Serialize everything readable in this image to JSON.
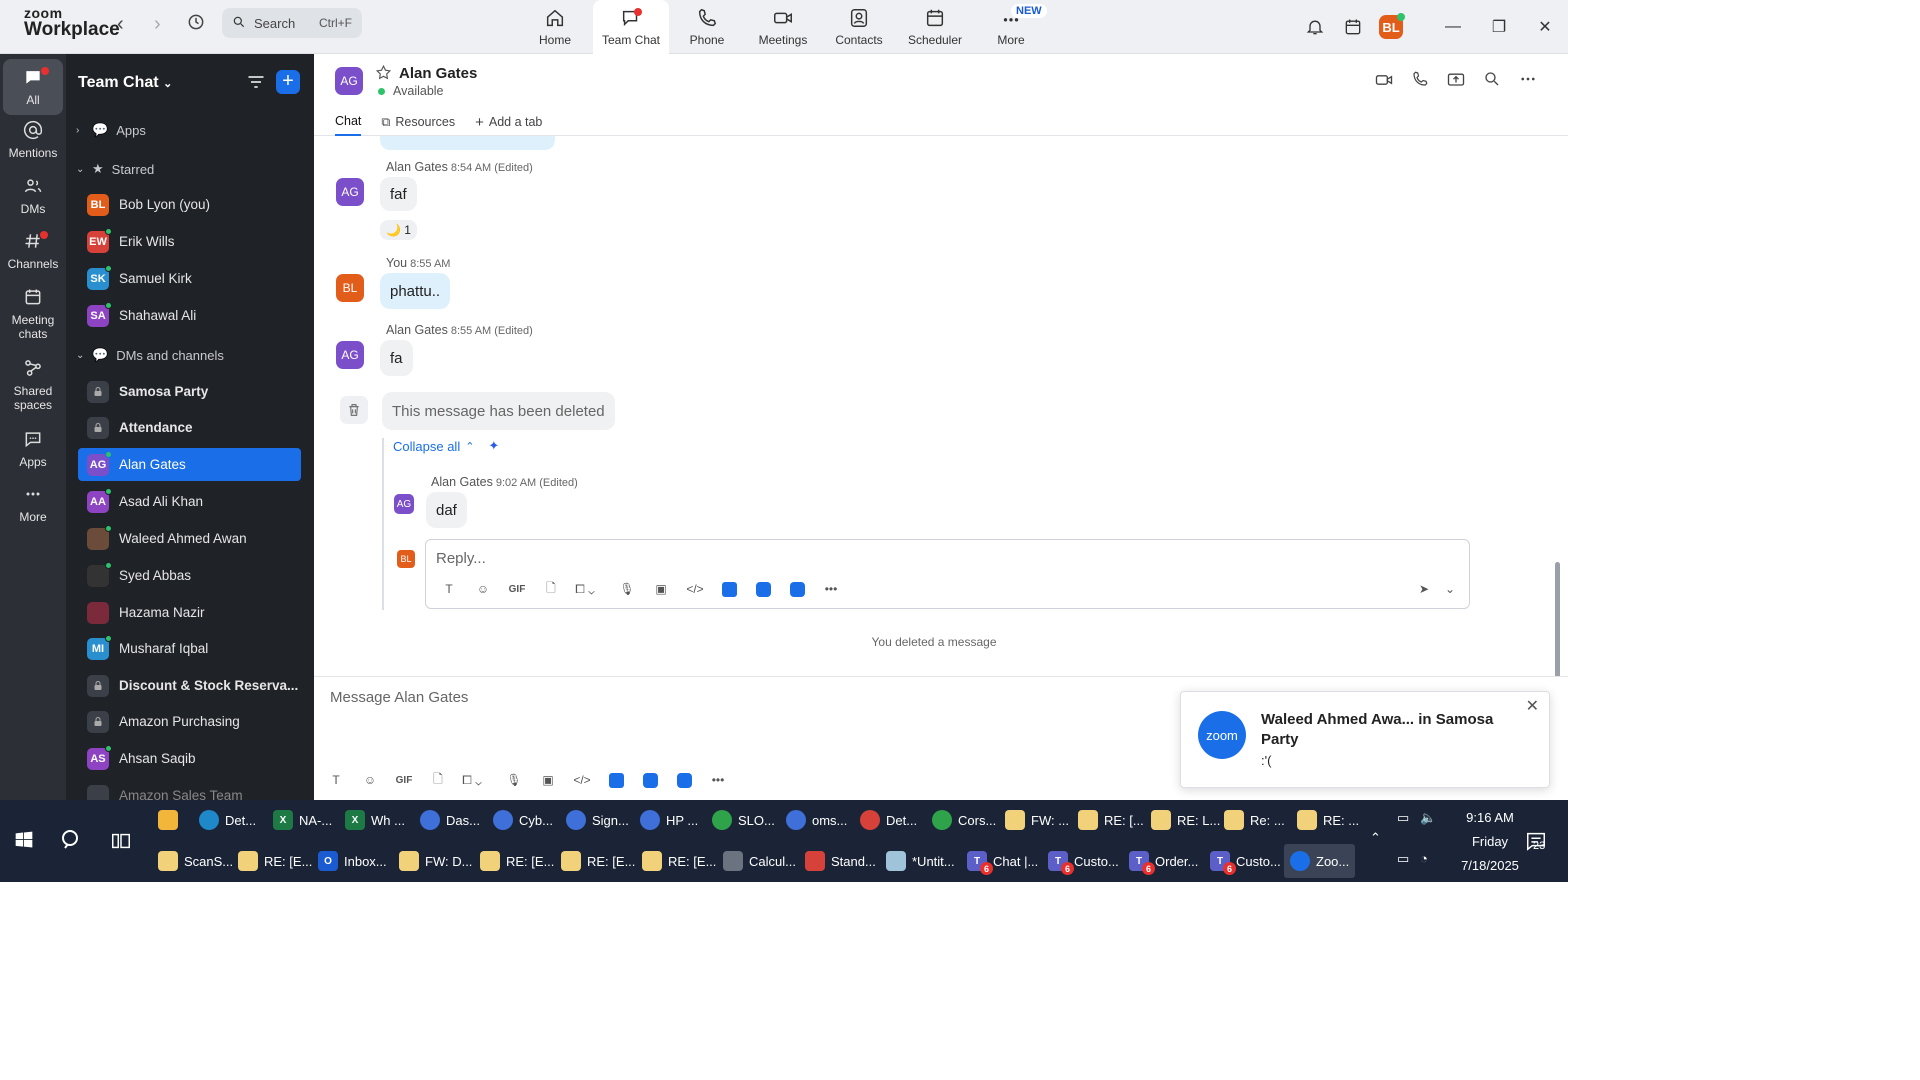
{
  "app": {
    "logo_line1": "zoom",
    "logo_line2": "Workplace"
  },
  "search": {
    "placeholder": "Search",
    "shortcut": "Ctrl+F"
  },
  "topnav": [
    {
      "label": "Home",
      "icon": "home-icon"
    },
    {
      "label": "Team Chat",
      "icon": "chat-icon",
      "active": true,
      "dot": true
    },
    {
      "label": "Phone",
      "icon": "phone-icon"
    },
    {
      "label": "Meetings",
      "icon": "video-icon"
    },
    {
      "label": "Contacts",
      "icon": "contacts-icon"
    },
    {
      "label": "Scheduler",
      "icon": "calendar-icon"
    },
    {
      "label": "More",
      "icon": "more-icon",
      "badge": "NEW"
    }
  ],
  "user": {
    "initials": "BL",
    "color": "#e35d1a"
  },
  "rail": [
    {
      "label": "All",
      "active": true
    },
    {
      "label": "Mentions"
    },
    {
      "label": "DMs"
    },
    {
      "label": "Channels"
    },
    {
      "label": "Meeting chats"
    },
    {
      "label": "Shared spaces"
    },
    {
      "label": "Apps"
    },
    {
      "label": "More"
    }
  ],
  "sidebar": {
    "title": "Team Chat",
    "sections": {
      "apps": "Apps",
      "starred": "Starred",
      "dms": "DMs and channels"
    },
    "starred": [
      {
        "initials": "BL",
        "name": "Bob Lyon (you)",
        "color": "#e35d1a"
      },
      {
        "initials": "EW",
        "name": "Erik Wills",
        "color": "#d6413a"
      },
      {
        "initials": "SK",
        "name": "Samuel Kirk",
        "color": "#2a8fcf"
      },
      {
        "initials": "SA",
        "name": "Shahawal Ali",
        "color": "#8e44c2"
      }
    ],
    "dms": [
      {
        "name": "Samosa Party",
        "type": "lock",
        "bold": true
      },
      {
        "name": "Attendance",
        "type": "lock",
        "bold": true
      },
      {
        "initials": "AG",
        "name": "Alan Gates",
        "color": "#7b4fc9",
        "active": true
      },
      {
        "initials": "AA",
        "name": "Asad Ali Khan",
        "color": "#8e44c2"
      },
      {
        "initials": "",
        "name": "Waleed Ahmed Awan",
        "color": "#6b4b3a"
      },
      {
        "initials": "",
        "name": "Syed Abbas",
        "color": "#333"
      },
      {
        "initials": "",
        "name": "Hazama Nazir",
        "color": "#7a2a3a"
      },
      {
        "initials": "MI",
        "name": "Musharaf Iqbal",
        "color": "#2a8fcf"
      },
      {
        "name": "Discount & Stock Reserva...",
        "type": "lock",
        "bold": true
      },
      {
        "name": "Amazon Purchasing",
        "type": "lock"
      },
      {
        "initials": "AS",
        "name": "Ahsan Saqib",
        "color": "#8e44c2"
      },
      {
        "name": "Amazon Sales Team",
        "type": "lock"
      }
    ]
  },
  "chat": {
    "contact": {
      "initials": "AG",
      "name": "Alan Gates",
      "status": "Available"
    },
    "tabs": {
      "chat": "Chat",
      "resources": "Resources",
      "add": "Add a tab"
    },
    "messages": {
      "m1": {
        "sender": "Alan Gates",
        "time": "8:54 AM (Edited)",
        "text": "faf",
        "reaction": "🌙 1"
      },
      "m2": {
        "sender": "You",
        "time": "8:55 AM",
        "text": "phattu.."
      },
      "m3": {
        "sender": "Alan Gates",
        "time": "8:55 AM (Edited)",
        "text": "fa"
      },
      "deleted": "This message has been deleted",
      "collapse": "Collapse all",
      "m4": {
        "sender": "Alan Gates",
        "time": "9:02 AM (Edited)",
        "text": "daf"
      },
      "reply_placeholder": "Reply...",
      "system": "You deleted a message"
    },
    "composer_placeholder": "Message Alan Gates"
  },
  "toast": {
    "title": "Waleed Ahmed Awa... in Samosa Party",
    "body": ":'(",
    "logo": "zoom"
  },
  "taskbar": {
    "row1": [
      "Det...",
      "NA-...",
      "Wh ...",
      "Das...",
      "Cyb...",
      "Sign...",
      "HP ...",
      "SLO...",
      "oms...",
      "Det...",
      "Cors...",
      "FW: ...",
      "RE: [...",
      "RE: L...",
      "Re: ...",
      "RE: ..."
    ],
    "row2": [
      "ScanS...",
      "RE: [E...",
      "Inbox...",
      "FW: D...",
      "RE: [E...",
      "RE: [E...",
      "RE: [E...",
      "Calcul...",
      "Stand...",
      "*Untit...",
      "Chat |...",
      "Custo...",
      "Order...",
      "Custo...",
      "Zoo..."
    ],
    "time": "9:16 AM",
    "day": "Friday",
    "date": "7/18/2025",
    "notifications": "23"
  }
}
